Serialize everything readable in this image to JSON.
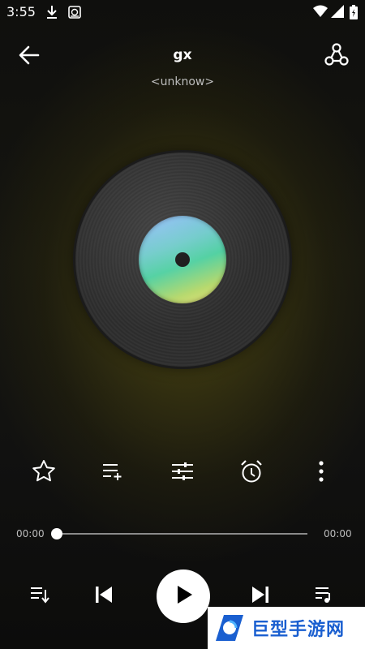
{
  "status_bar": {
    "time": "3:55",
    "icons": [
      "download-icon",
      "sd-card-icon",
      "wifi-icon",
      "signal-icon",
      "battery-charging-icon"
    ]
  },
  "header": {
    "title": "gx",
    "artist": "<unknow>",
    "back_icon": "arrow-left-icon",
    "share_icon": "share-icon"
  },
  "actions": [
    {
      "name": "favorite",
      "icon": "star-icon"
    },
    {
      "name": "add-to-playlist",
      "icon": "playlist-add-icon"
    },
    {
      "name": "equalizer",
      "icon": "equalizer-icon"
    },
    {
      "name": "sleep-timer",
      "icon": "alarm-icon"
    },
    {
      "name": "more",
      "icon": "more-vert-icon"
    }
  ],
  "progress": {
    "current": "00:00",
    "total": "00:00",
    "fraction": 0
  },
  "controls": {
    "playlist_icon": "queue-icon",
    "prev_icon": "skip-previous-icon",
    "play_icon": "play-icon",
    "next_icon": "skip-next-icon",
    "lyrics_icon": "lyrics-icon"
  },
  "watermark": {
    "text": "巨型手游网"
  },
  "colors": {
    "accent": "#ffffff",
    "background_glow": "#6e6414",
    "label_gradient": [
      "#8fb8ff",
      "#4ccf9f",
      "#f0e27a"
    ],
    "watermark_blue": "#1a5fd0"
  }
}
